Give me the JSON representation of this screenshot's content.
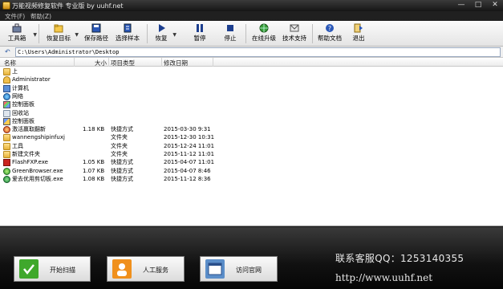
{
  "window": {
    "title": "万能视频修复软件 专业版 by uuhf.net",
    "controls": [
      "—",
      "□",
      "✕"
    ]
  },
  "menu": [
    "文件(F)",
    "帮助(Z)"
  ],
  "toolbar": {
    "items": [
      {
        "label": "工具箱",
        "icon": "toolbox-icon",
        "dropdown": true
      },
      {
        "label": "恢复目标",
        "icon": "folder-target-icon",
        "dropdown": true
      },
      {
        "label": "保存路径",
        "icon": "save-disk-icon",
        "dropdown": false
      },
      {
        "label": "选择样本",
        "icon": "sample-icon",
        "dropdown": false
      },
      {
        "label": "恢复",
        "icon": "play-icon",
        "dropdown": true
      },
      {
        "label": "暂停",
        "icon": "pause-icon",
        "dropdown": false
      },
      {
        "label": "停止",
        "icon": "stop-icon",
        "dropdown": false
      },
      {
        "label": "在线升级",
        "icon": "globe-icon",
        "dropdown": false
      },
      {
        "label": "技术支持",
        "icon": "support-icon",
        "dropdown": false
      },
      {
        "label": "帮助文档",
        "icon": "help-icon",
        "dropdown": false
      },
      {
        "label": "退出",
        "icon": "exit-icon",
        "dropdown": false
      }
    ]
  },
  "path": {
    "value": "C:\\Users\\Administrator\\Desktop"
  },
  "table": {
    "headers": [
      "名称",
      "大小",
      "项目类型",
      "修改日期"
    ],
    "rows": [
      {
        "icon": "folder",
        "name": "上",
        "size": "",
        "type": "",
        "date": ""
      },
      {
        "icon": "user",
        "name": "Administrator",
        "size": "",
        "type": "",
        "date": ""
      },
      {
        "icon": "computer",
        "name": "计算机",
        "size": "",
        "type": "",
        "date": ""
      },
      {
        "icon": "network",
        "name": "网络",
        "size": "",
        "type": "",
        "date": ""
      },
      {
        "icon": "panel",
        "name": "控制面板",
        "size": "",
        "type": "",
        "date": ""
      },
      {
        "icon": "recycle",
        "name": "回收站",
        "size": "",
        "type": "",
        "date": ""
      },
      {
        "icon": "panel2",
        "name": "控制面板",
        "size": "",
        "type": "",
        "date": ""
      },
      {
        "icon": "app-red",
        "name": "激活赢取翻新",
        "size": "1.18 KB",
        "type": "快捷方式",
        "date": "2015-03-30 9:31"
      },
      {
        "icon": "folder",
        "name": "wannengshipinfuxj",
        "size": "",
        "type": "文件夹",
        "date": "2015-12-30 10:31"
      },
      {
        "icon": "folder",
        "name": "工具",
        "size": "",
        "type": "文件夹",
        "date": "2015-12-24 11:01"
      },
      {
        "icon": "folder",
        "name": "新建文件夹",
        "size": "",
        "type": "文件夹",
        "date": "2015-11-12 11:01"
      },
      {
        "icon": "flash",
        "name": "FlashFXP.exe",
        "size": "1.05 KB",
        "type": "快捷方式",
        "date": "2015-04-07 11:01"
      },
      {
        "icon": "browser",
        "name": "GreenBrowser.exe",
        "size": "1.07 KB",
        "type": "快捷方式",
        "date": "2015-04-07 8:46"
      },
      {
        "icon": "cut",
        "name": "爱去优用剪切板.exe",
        "size": "1.08 KB",
        "type": "快捷方式",
        "date": "2015-11-12 8:36"
      }
    ]
  },
  "bottom": {
    "buttons": [
      {
        "label": "开始扫描",
        "icon": "checkmark-icon",
        "color": "#3fa82c"
      },
      {
        "label": "人工服务",
        "icon": "service-icon",
        "color": "#f0901c"
      },
      {
        "label": "访问官网",
        "icon": "website-icon",
        "color": "#5b8ec9"
      }
    ],
    "qq": "联系客服QQ：1253140355",
    "url": "http://www.uuhf.net"
  }
}
